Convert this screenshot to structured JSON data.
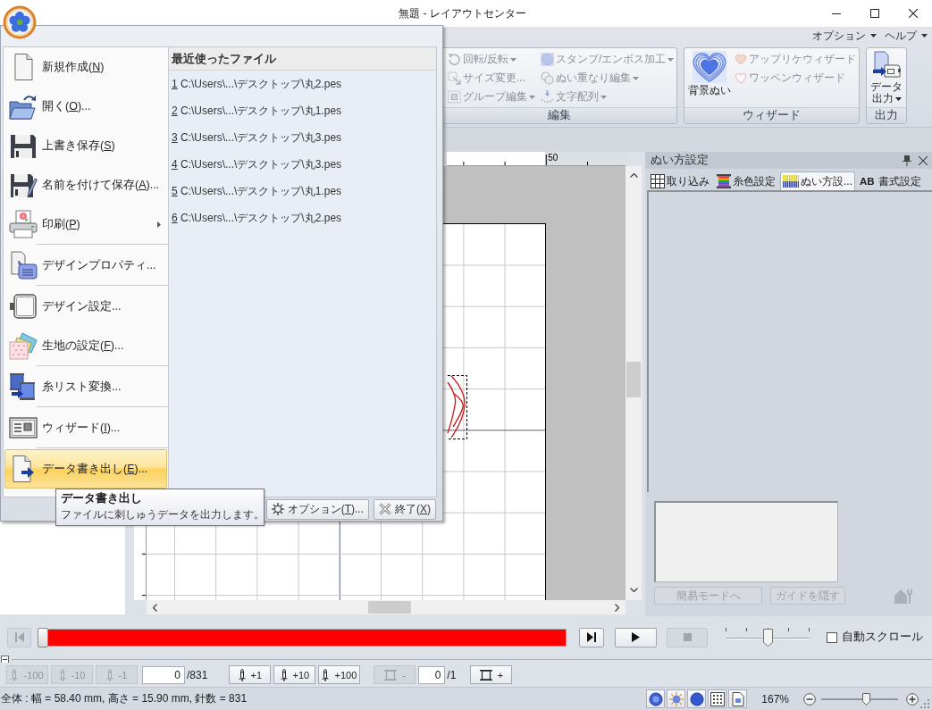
{
  "title_bar": {
    "title": "無題 - レイアウトセンター"
  },
  "ribbon": {
    "menus": [
      {
        "label": "オプション",
        "dropdown": true
      },
      {
        "label": "ヘルプ",
        "dropdown": true
      }
    ],
    "groups": [
      {
        "kind": "grid",
        "label": "編集",
        "items": [
          {
            "label": "回転/反転",
            "dropdown": true,
            "disabled": true
          },
          {
            "label": "サイズ変更...",
            "dropdown": false,
            "disabled": true
          },
          {
            "label": "グループ編集",
            "dropdown": true,
            "disabled": true
          },
          {
            "label": "スタンプ/エンボス加工",
            "dropdown": true,
            "disabled": true
          },
          {
            "label": "ぬい重なり編集",
            "dropdown": true,
            "disabled": true
          },
          {
            "label": "文字配列",
            "dropdown": true,
            "disabled": true
          }
        ]
      },
      {
        "kind": "mixed",
        "label": "ウィザード",
        "large_buttons": [
          {
            "label_lines": [
              "背景ぬい"
            ],
            "dropdown": false,
            "disabled": false
          }
        ],
        "items": [
          {
            "label": "アップリケウィザード",
            "dropdown": false,
            "disabled": true
          },
          {
            "label": "ワッペンウィザード",
            "dropdown": false,
            "disabled": true
          }
        ]
      },
      {
        "kind": "mixed",
        "label": "出力",
        "large_buttons": [
          {
            "label_lines": [
              "データ",
              "出力"
            ],
            "dropdown": true,
            "disabled": false
          }
        ]
      }
    ]
  },
  "canvas": {
    "ruler_labels": [
      "50"
    ]
  },
  "side_panel": {
    "title": "ぬい方設定",
    "tabs": [
      {
        "label": "取り込み",
        "selected": false
      },
      {
        "label": "糸色設定",
        "selected": false
      },
      {
        "label": "ぬい方設...",
        "selected": true
      },
      {
        "icon_text": "AB",
        "label": "書式設定",
        "selected": false
      }
    ],
    "buttons": [
      {
        "label": "簡易モードへ",
        "disabled": true
      },
      {
        "label": "ガイドを隠す",
        "disabled": true
      }
    ]
  },
  "simulator": {
    "start_button": {
      "disabled": true
    },
    "progress": {
      "level": 0
    },
    "end_button": {
      "disabled": false
    },
    "play_button": {
      "disabled": false
    },
    "stop_button": {
      "disabled": true
    },
    "speed": {
      "level": 0.5
    },
    "auto_scroll": {
      "label": "自動スクロール",
      "checked": false
    }
  },
  "stitch_step": {
    "back_buttons": [
      {
        "label": "-100",
        "disabled": true
      },
      {
        "label": "-10",
        "disabled": true
      },
      {
        "label": "-1",
        "disabled": true
      }
    ],
    "value": "0",
    "total": "/831",
    "forward_buttons": [
      {
        "label": "+1",
        "disabled": false
      },
      {
        "label": "+10",
        "disabled": false
      },
      {
        "label": "+100",
        "disabled": false
      }
    ]
  },
  "color_step": {
    "back_button": {
      "label": "-",
      "disabled": true
    },
    "value": "0",
    "total": "/1",
    "forward_button": {
      "label": "+",
      "disabled": false
    }
  },
  "status_bar": {
    "text": "全体 : 幅 = 58.40 mm, 高さ = 15.90 mm, 針数 = 831",
    "zoom": {
      "label": "167%",
      "level": 0.6
    }
  },
  "app_menu": {
    "sections": [
      [
        {
          "text": "新規作成(",
          "key": "N",
          "rest": ")",
          "selected": false
        },
        {
          "text": "開く(",
          "key": "O",
          "rest": ")...",
          "selected": false
        },
        {
          "text": "上書き保存(",
          "key": "S",
          "rest": ")",
          "selected": false
        },
        {
          "text": "名前を付けて保存(",
          "key": "A",
          "rest": ")...",
          "selected": false
        },
        {
          "text": "印刷(",
          "key": "P",
          "rest": ")",
          "submenu": true,
          "selected": false
        }
      ],
      [
        {
          "text": "デザインプロパティ...",
          "selected": false
        }
      ],
      [
        {
          "text": "デザイン設定...",
          "selected": false
        },
        {
          "text": "生地の設定(",
          "key": "F",
          "rest": ")...",
          "selected": false
        }
      ],
      [
        {
          "text": "糸リスト変換...",
          "selected": false
        }
      ],
      [
        {
          "text": "ウィザード(",
          "key": "I",
          "rest": ")...",
          "selected": false
        }
      ],
      [
        {
          "text": "データ書き出し(",
          "key": "E",
          "rest": ")...",
          "selected": true
        }
      ]
    ],
    "recent_title": "最近使ったファイル",
    "recent_files": [
      "1 C:\\Users\\...\\デスクトップ\\丸2.pes",
      "2 C:\\Users\\...\\デスクトップ\\丸1.pes",
      "3 C:\\Users\\...\\デスクトップ\\丸3.pes",
      "4 C:\\Users\\...\\デスクトップ\\丸3.pes",
      "5 C:\\Users\\...\\デスクトップ\\丸1.pes",
      "6 C:\\Users\\...\\デスクトップ\\丸2.pes"
    ],
    "buttons": [
      {
        "text": "オプション(",
        "key": "T",
        "rest": ")..."
      },
      {
        "text": "終了(",
        "key": "X",
        "rest": ")"
      }
    ]
  },
  "tooltip": {
    "title": "データ書き出し",
    "text": "ファイルに刺しゅうデータを出力します。"
  }
}
